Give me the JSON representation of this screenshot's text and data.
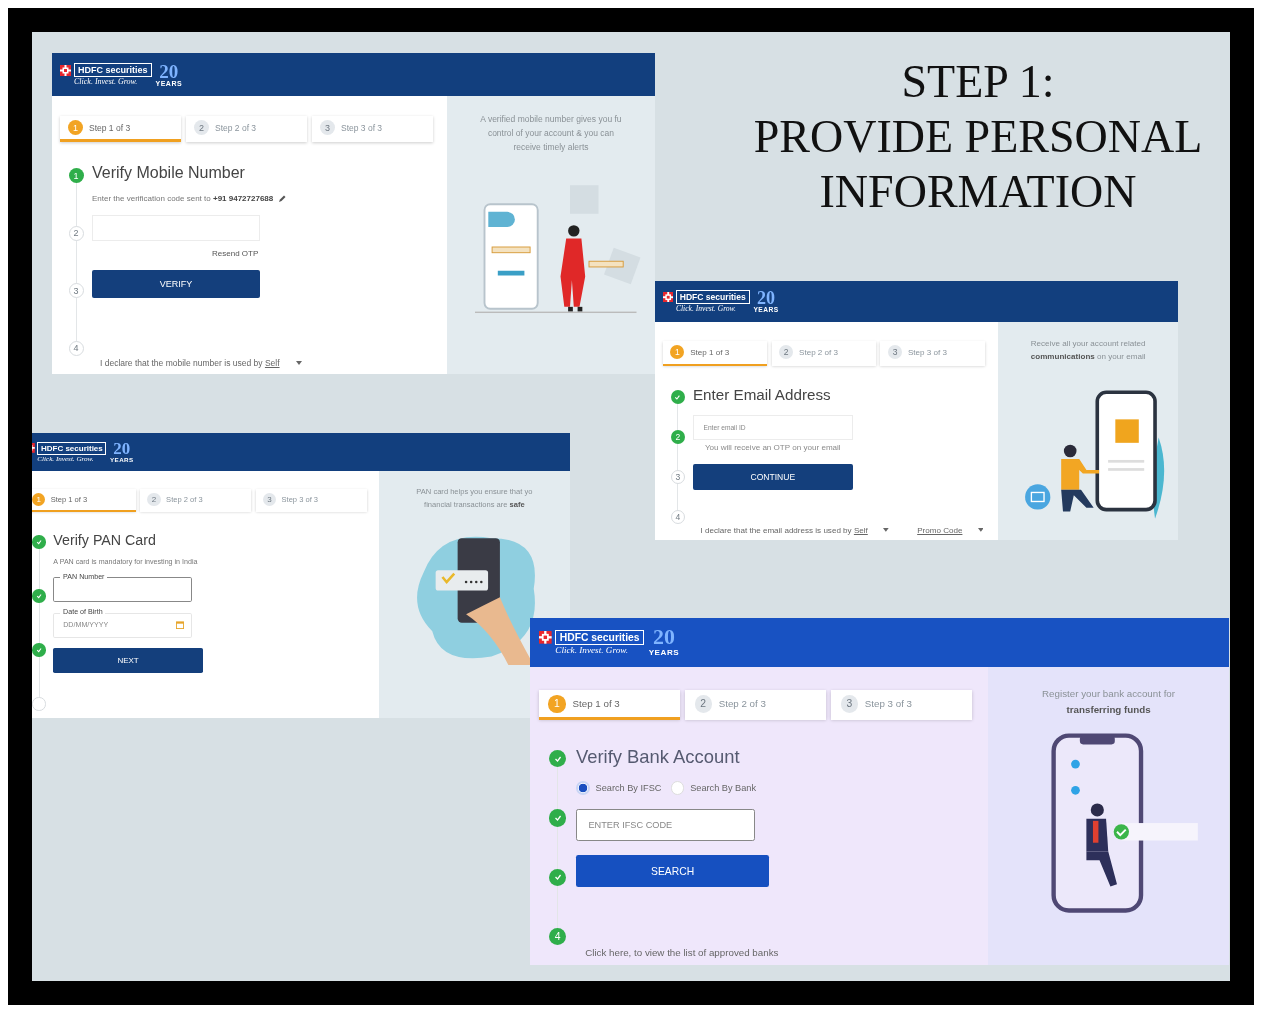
{
  "heading": {
    "lines": [
      "STEP 1:",
      "PROVIDE PERSONAL",
      "INFORMATION"
    ]
  },
  "screens": [
    {
      "logo": {
        "brand": "HDFC securities",
        "tagline": "Click. Invest. Grow.",
        "badge": "20",
        "badge_caption": "YEARS"
      },
      "tabs": [
        {
          "number": "1",
          "label": "Step 1 of 3",
          "selected": true
        },
        {
          "number": "2",
          "label": "Step 2 of 3",
          "selected": false
        },
        {
          "number": "3",
          "label": "Step 3 of 3",
          "selected": false
        }
      ],
      "steps": [
        {
          "completed": false,
          "active": true,
          "number": "1"
        },
        {
          "completed": false,
          "active": false,
          "number": "2"
        },
        {
          "completed": false,
          "active": false,
          "number": "3"
        },
        {
          "completed": false,
          "active": false,
          "number": "4"
        }
      ],
      "title": "Verify Mobile Number",
      "items": [
        {
          "kind": "editable-note",
          "text": "Enter the verification code sent to **+91 9472727688**"
        },
        {
          "kind": "field"
        },
        {
          "kind": "link",
          "text": "Resend OTP"
        },
        {
          "kind": "button",
          "text": "VERIFY"
        }
      ],
      "footer": [
        {
          "kind": "dropdown",
          "text": "I declare that the mobile number is used by **Self**"
        }
      ],
      "promo": {
        "lines": [
          "A verified mobile number gives you fu",
          "control of your account & you can",
          "receive timely alerts"
        ]
      }
    },
    {
      "logo": {
        "brand": "HDFC securities",
        "tagline": "Click. Invest. Grow.",
        "badge": "20",
        "badge_caption": "YEARS"
      },
      "tabs": [
        {
          "number": "1",
          "label": "Step 1 of 3",
          "selected": true
        },
        {
          "number": "2",
          "label": "Step 2 of 3",
          "selected": false
        },
        {
          "number": "3",
          "label": "Step 3 of 3",
          "selected": false
        }
      ],
      "steps": [
        {
          "completed": true,
          "active": false
        },
        {
          "completed": false,
          "active": true,
          "number": "2"
        },
        {
          "completed": false,
          "active": false,
          "number": "3"
        },
        {
          "completed": false,
          "active": false,
          "number": "4"
        }
      ],
      "title": "Enter Email Address",
      "items": [
        {
          "kind": "field",
          "placeholder": "Enter email ID"
        },
        {
          "kind": "hint",
          "text": "You will receive an OTP on your email"
        },
        {
          "kind": "button",
          "text": "CONTINUE"
        }
      ],
      "footer": [
        {
          "kind": "dropdown",
          "text": "I declare that the email address is used by **Self**"
        },
        {
          "kind": "link",
          "text": "Promo Code"
        }
      ],
      "promo": {
        "lines": [
          "Receive all your account related",
          "**communications** on your email"
        ]
      }
    },
    {
      "logo": {
        "brand": "HDFC securities",
        "tagline": "Click. Invest. Grow.",
        "badge": "20",
        "badge_caption": "YEARS"
      },
      "tabs": [
        {
          "number": "1",
          "label": "Step 1 of 3",
          "selected": true
        },
        {
          "number": "2",
          "label": "Step 2 of 3",
          "selected": false
        },
        {
          "number": "3",
          "label": "Step 3 of 3",
          "selected": false
        }
      ],
      "steps": [
        {
          "completed": true,
          "active": false
        },
        {
          "completed": true,
          "active": false
        },
        {
          "completed": true,
          "active": false
        },
        {
          "completed": false,
          "active": false
        }
      ],
      "title": "Verify PAN Card",
      "items": [
        {
          "kind": "note",
          "text": "A PAN card is mandatory for investing in India"
        },
        {
          "kind": "outlined-field",
          "label": "PAN Number"
        },
        {
          "kind": "date-field",
          "label": "Date of Birth",
          "placeholder": "DD/MM/YYYY"
        },
        {
          "kind": "button",
          "text": "NEXT"
        }
      ],
      "promo": {
        "lines": [
          "PAN card helps you ensure that yo",
          "financial transactions are **safe**"
        ]
      }
    },
    {
      "logo": {
        "brand": "HDFC securities",
        "tagline": "Click. Invest. Grow.",
        "badge": "20",
        "badge_caption": "YEARS"
      },
      "tabs": [
        {
          "number": "1",
          "label": "Step 1 of 3",
          "selected": true
        },
        {
          "number": "2",
          "label": "Step 2 of 3",
          "selected": false
        },
        {
          "number": "3",
          "label": "Step 3 of 3",
          "selected": false
        }
      ],
      "steps": [
        {
          "completed": true,
          "active": false
        },
        {
          "completed": true,
          "active": false
        },
        {
          "completed": true,
          "active": false
        },
        {
          "completed": false,
          "active": true,
          "number": "4"
        }
      ],
      "title": "Verify Bank Account",
      "items": [
        {
          "kind": "radios",
          "options": [
            {
              "label": "Search By IFSC",
              "selected": true
            },
            {
              "label": "Search By Bank",
              "selected": false
            }
          ]
        },
        {
          "kind": "outlined-field",
          "placeholder": "ENTER IFSC CODE"
        },
        {
          "kind": "button",
          "text": "SEARCH"
        }
      ],
      "footer": [
        {
          "kind": "note",
          "text": "Click here, to view the list of approved banks"
        }
      ],
      "promo": {
        "lines": [
          "Register your bank account for",
          "**transferring funds**"
        ]
      }
    }
  ]
}
